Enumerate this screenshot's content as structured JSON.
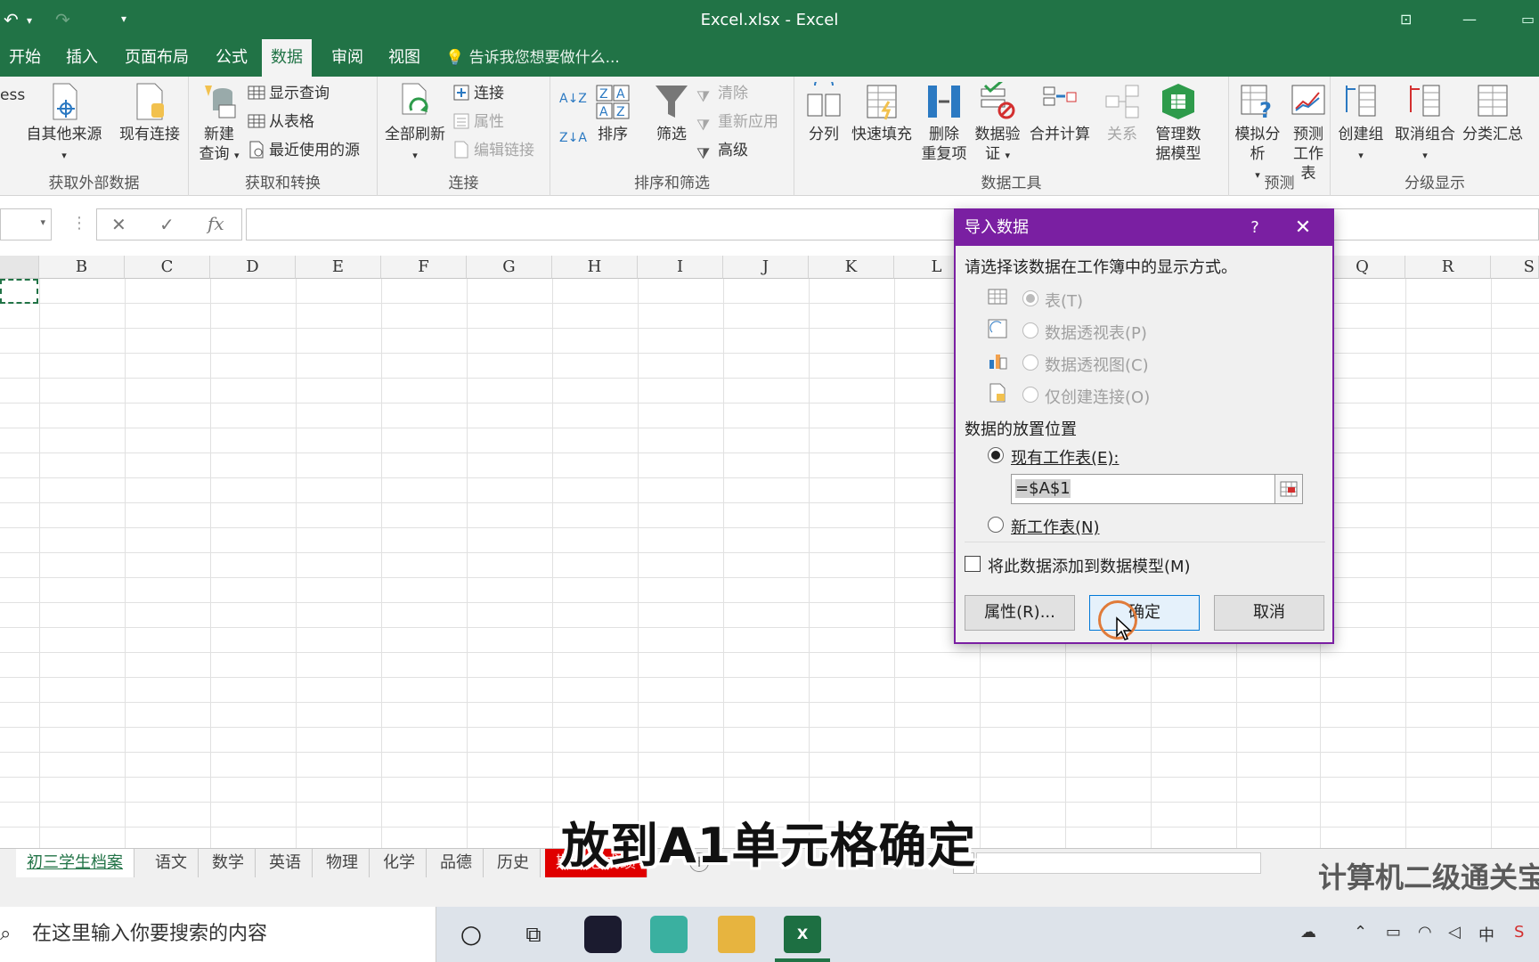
{
  "titlebar": {
    "title": "Excel.xlsx - Excel"
  },
  "tabs": {
    "items": [
      "开始",
      "插入",
      "页面布局",
      "公式",
      "数据",
      "审阅",
      "视图"
    ],
    "active": "数据",
    "tellme": "告诉我您想要做什么..."
  },
  "ribbon": {
    "ess": "ess",
    "get_external": {
      "from_other": "自其他来源",
      "existing": "现有连接",
      "label": "获取外部数据"
    },
    "get_transform": {
      "new_query_1": "新建",
      "new_query_2": "查询",
      "show_queries": "显示查询",
      "from_table": "从表格",
      "recent_sources": "最近使用的源",
      "label": "获取和转换"
    },
    "connections": {
      "refresh_all": "全部刷新",
      "connections": "连接",
      "properties": "属性",
      "edit_links": "编辑链接",
      "label": "连接"
    },
    "sort_filter": {
      "sort": "排序",
      "filter": "筛选",
      "clear": "清除",
      "reapply": "重新应用",
      "advanced": "高级",
      "label": "排序和筛选"
    },
    "data_tools": {
      "text_to_columns": "分列",
      "flash_fill": "快速填充",
      "remove_dup_1": "删除",
      "remove_dup_2": "重复项",
      "validation_1": "数据验",
      "validation_2": "证",
      "consolidate": "合并计算",
      "relationships": "关系",
      "manage_model_1": "管理数",
      "manage_model_2": "据模型",
      "label": "数据工具"
    },
    "forecast": {
      "what_if": "模拟分析",
      "forecast_1": "预测",
      "forecast_2": "工作表",
      "label": "预测"
    },
    "outline": {
      "group": "创建组",
      "ungroup": "取消组合",
      "subtotal": "分类汇总",
      "label": "分级显示"
    }
  },
  "columns": [
    "B",
    "C",
    "D",
    "E",
    "F",
    "G",
    "H",
    "I",
    "J",
    "K",
    "L",
    "Q",
    "R",
    "S"
  ],
  "dialog": {
    "title": "导入数据",
    "help": "?",
    "prompt": "请选择该数据在工作簿中的显示方式。",
    "options": {
      "table": "表(T)",
      "pivot_table": "数据透视表(P)",
      "pivot_chart": "数据透视图(C)",
      "connection_only": "仅创建连接(O)"
    },
    "placement_label": "数据的放置位置",
    "existing_sheet": "现有工作表(E):",
    "reference": "=$A$1",
    "new_sheet": "新工作表(N)",
    "add_to_model": "将此数据添加到数据模型(M)",
    "buttons": {
      "properties": "属性(R)...",
      "ok": "确定",
      "cancel": "取消"
    }
  },
  "sheets": {
    "items": [
      "初三学生档案",
      "语文",
      "数学",
      "英语",
      "物理",
      "化学",
      "品德",
      "历史",
      "期末总成绩"
    ],
    "active": "初三学生档案"
  },
  "caption": "放到A1单元格确定",
  "watermark": "计算机二级通关宝",
  "taskbar": {
    "search_placeholder": "在这里输入你要搜索的内容",
    "ime": "中"
  },
  "colors": {
    "excel_green": "#217346",
    "dialog_purple": "#7a1fa2",
    "sheet_red": "#e00000"
  }
}
